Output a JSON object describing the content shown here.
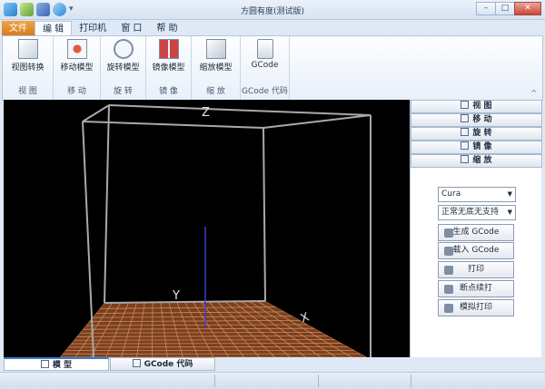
{
  "window": {
    "title": "方圆有度(测试版)",
    "controls": [
      "–",
      "□",
      "✕"
    ]
  },
  "menu_tabs": [
    {
      "label": "文件",
      "kind": "file"
    },
    {
      "label": "编 辑",
      "kind": "active"
    },
    {
      "label": "打印机",
      "kind": "normal"
    },
    {
      "label": "窗 口",
      "kind": "normal"
    },
    {
      "label": "帮 助",
      "kind": "normal"
    }
  ],
  "ribbon": {
    "groups": [
      {
        "label": "视 图",
        "buttons": [
          {
            "label": "视图转换",
            "icon": "cube-icon"
          }
        ]
      },
      {
        "label": "移 动",
        "buttons": [
          {
            "label": "移动模型",
            "icon": "move-icon"
          }
        ]
      },
      {
        "label": "旋 转",
        "buttons": [
          {
            "label": "旋转模型",
            "icon": "rotate-icon"
          }
        ]
      },
      {
        "label": "镜 像",
        "buttons": [
          {
            "label": "镜像模型",
            "icon": "mirror-icon"
          }
        ]
      },
      {
        "label": "缩 放",
        "buttons": [
          {
            "label": "缩放模型",
            "icon": "scale-icon"
          }
        ]
      },
      {
        "label": "GCode 代码",
        "buttons": [
          {
            "label": "GCode",
            "icon": "gcode-file-icon"
          }
        ]
      }
    ],
    "collapse_glyph": "^"
  },
  "viewport": {
    "axis_z": "Z",
    "axis_y": "Y",
    "axis_x": "X",
    "platform_color": "#7a3f1c",
    "grid_line_color": "#c98a5e",
    "frame_color": "#a9a9a9"
  },
  "panel": {
    "tabs": [
      "视 图",
      "移 动",
      "旋 转",
      "镜 像",
      "缩 放"
    ],
    "slicer_select": "Cura",
    "support_select": "正常无底无支持",
    "actions": [
      "生成 GCode",
      "载入 GCode",
      "打印",
      "断点续打",
      "模拟打印"
    ]
  },
  "bottom_tabs": [
    {
      "label": "模 型",
      "active": true
    },
    {
      "label": "GCode 代码",
      "active": false
    }
  ]
}
